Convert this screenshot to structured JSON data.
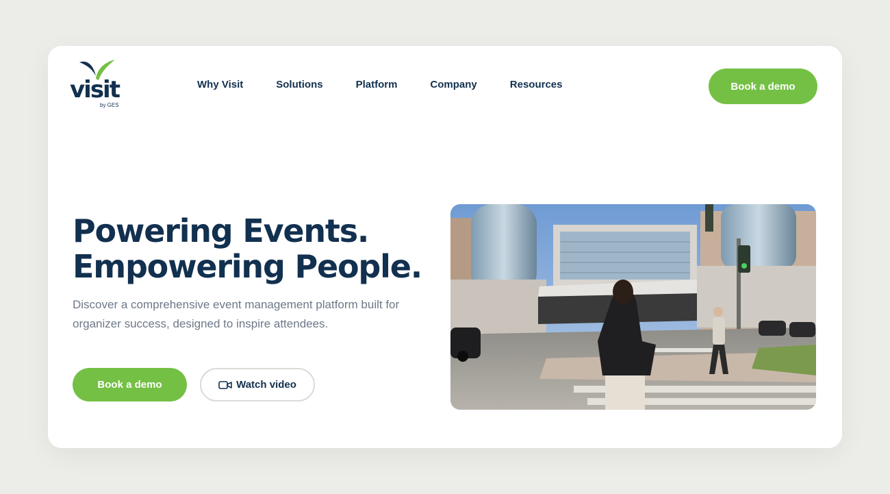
{
  "brand": {
    "name": "visit",
    "sub": "by GES",
    "colors": {
      "navy": "#12304f",
      "green": "#74c044"
    }
  },
  "nav": {
    "items": [
      {
        "label": "Why Visit"
      },
      {
        "label": "Solutions"
      },
      {
        "label": "Platform"
      },
      {
        "label": "Company"
      },
      {
        "label": "Resources"
      }
    ],
    "cta_label": "Book a demo"
  },
  "hero": {
    "title_line1": "Powering Events.",
    "title_line2": "Empowering People.",
    "subtitle": "Discover a comprehensive event management platform built for organizer success, designed to inspire attendees.",
    "primary_cta": "Book a demo",
    "secondary_cta": "Watch video",
    "secondary_cta_icon": "video-camera-icon"
  },
  "media": {
    "icon": "street-scene-video"
  }
}
